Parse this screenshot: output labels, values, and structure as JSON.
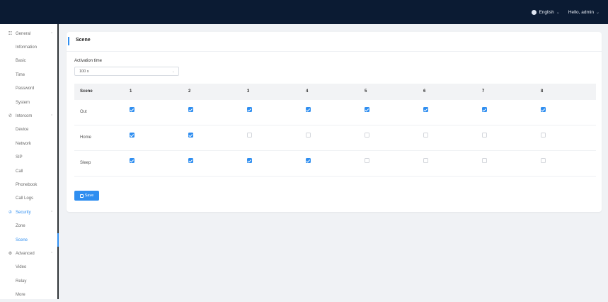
{
  "topbar": {
    "language": "English",
    "greeting": "Hello, admin"
  },
  "sidebar": {
    "groups": [
      {
        "label": "General",
        "icon": "grid-icon",
        "expanded": true,
        "items": [
          "Information",
          "Basic",
          "Time",
          "Password",
          "System"
        ]
      },
      {
        "label": "Intercom",
        "icon": "phone-icon",
        "expanded": true,
        "items": [
          "Device",
          "Network",
          "SIP",
          "Call",
          "Phonebook",
          "Call Logs"
        ]
      },
      {
        "label": "Security",
        "icon": "user-shield-icon",
        "expanded": true,
        "active": true,
        "items": [
          "Zone",
          "Scene"
        ]
      },
      {
        "label": "Advanced",
        "icon": "gear-icon",
        "expanded": true,
        "items": [
          "Video",
          "Relay",
          "More"
        ]
      }
    ],
    "selected_item": "Scene"
  },
  "card": {
    "title": "Scene",
    "activation_label": "Activation time",
    "activation_value": "100 s"
  },
  "table": {
    "headers": [
      "Scene",
      "1",
      "2",
      "3",
      "4",
      "5",
      "6",
      "7",
      "8"
    ],
    "rows": [
      {
        "label": "Out",
        "checks": [
          true,
          true,
          true,
          true,
          true,
          true,
          true,
          true
        ]
      },
      {
        "label": "Home",
        "checks": [
          true,
          true,
          false,
          false,
          false,
          false,
          false,
          false
        ]
      },
      {
        "label": "Sleep",
        "checks": [
          true,
          true,
          true,
          true,
          false,
          false,
          false,
          false
        ]
      }
    ]
  },
  "save_label": "Save",
  "colors": {
    "accent": "#2f8ef0",
    "topbar": "#0b1b33"
  }
}
